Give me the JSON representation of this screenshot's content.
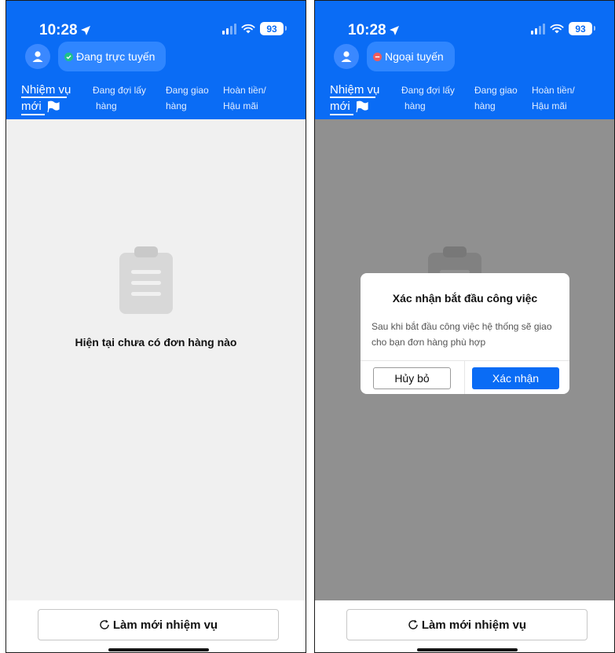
{
  "colors": {
    "brand_blue": "#0a6cf5",
    "online_green": "#1ec18a",
    "offline_red": "#f05a5a",
    "background_gray": "#f0f0f0"
  },
  "screens": [
    {
      "status_bar": {
        "time": "10:28",
        "battery": "93"
      },
      "profile": {
        "avatar_icon": "user-icon",
        "status_icon": "check-circle-icon",
        "status_text": "Đang trực tuyến"
      },
      "tabs": [
        {
          "line1": "Nhiệm vụ",
          "line2": "mới",
          "icon": "flag-icon"
        },
        {
          "line1": "Đang đợi lấy",
          "line2": "hàng"
        },
        {
          "line1": "Đang giao",
          "line2": "hàng"
        },
        {
          "line1": "Hoàn tiền/",
          "line2": "Hậu mãi"
        }
      ],
      "empty_state": {
        "icon": "clipboard-icon",
        "message": "Hiện tại chưa có đơn hàng nào"
      },
      "refresh_button": {
        "icon": "refresh-icon",
        "label": "Làm mới nhiệm vụ"
      }
    },
    {
      "status_bar": {
        "time": "10:28",
        "battery": "93"
      },
      "profile": {
        "avatar_icon": "user-icon",
        "status_icon": "offline-dot-icon",
        "status_text": "Ngoại tuyến"
      },
      "tabs": [
        {
          "line1": "Nhiệm vụ",
          "line2": "mới",
          "icon": "flag-icon"
        },
        {
          "line1": "Đang đợi lấy",
          "line2": "hàng"
        },
        {
          "line1": "Đang giao",
          "line2": "hàng"
        },
        {
          "line1": "Hoàn tiền/",
          "line2": "Hậu mãi"
        }
      ],
      "empty_state": {
        "icon": "clipboard-icon"
      },
      "dialog": {
        "title": "Xác nhận bắt đầu công việc",
        "message": "Sau khi bắt đầu công việc hệ thống sẽ giao cho bạn đơn hàng phù hợp",
        "cancel_label": "Hủy bỏ",
        "confirm_label": "Xác nhận"
      },
      "refresh_button": {
        "icon": "refresh-icon",
        "label": "Làm mới nhiệm vụ"
      }
    }
  ]
}
